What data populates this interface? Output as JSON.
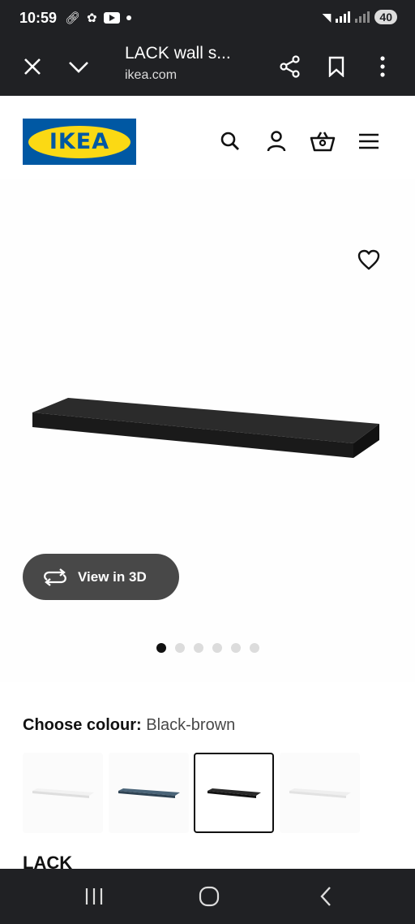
{
  "status_bar": {
    "time": "10:59",
    "battery": "40"
  },
  "browser": {
    "title": "LACK wall s...",
    "url": "ikea.com"
  },
  "brand": {
    "logo_text": "IKEA",
    "colors": {
      "blue": "#0058a3",
      "yellow": "#fbd914"
    }
  },
  "gallery": {
    "view_3d_label": "View in 3D",
    "slide_count": 6,
    "active_slide": 1
  },
  "colour": {
    "label": "Choose colour:",
    "value": "Black-brown",
    "swatches": [
      {
        "name": "White",
        "color": "#f4f4f4"
      },
      {
        "name": "Dark blue",
        "color": "#3c5366"
      },
      {
        "name": "Black-brown",
        "color": "#1f1f1f",
        "selected": true
      },
      {
        "name": "White stained oak effect",
        "color": "#ededed"
      }
    ]
  },
  "product": {
    "name": "LACK"
  }
}
